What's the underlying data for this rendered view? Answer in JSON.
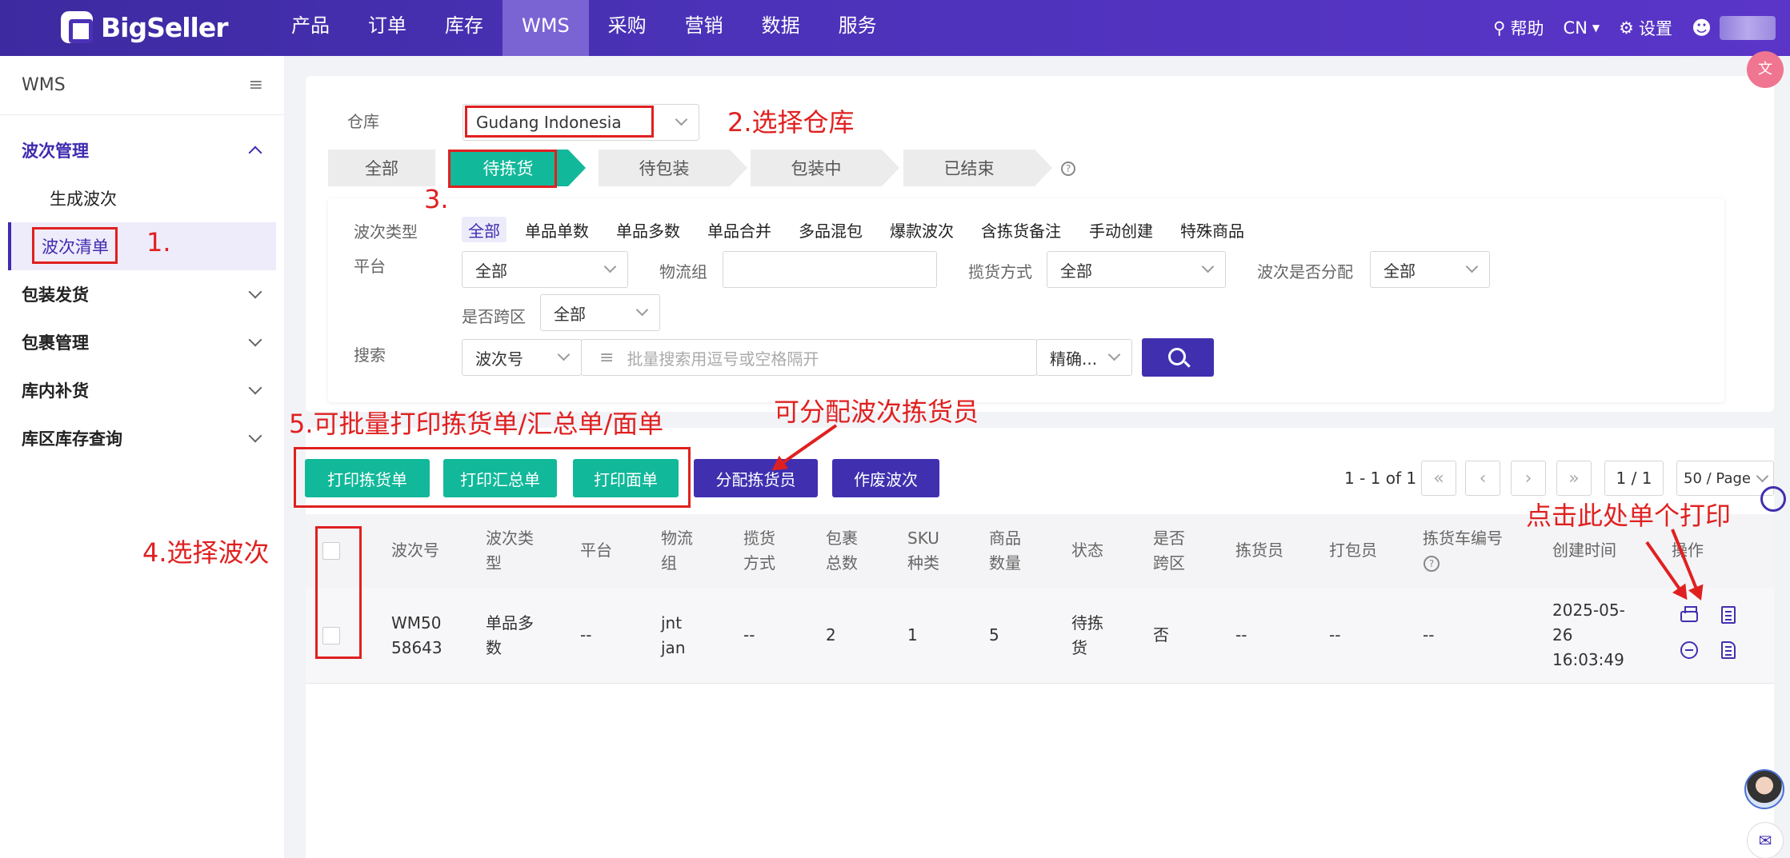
{
  "brand": {
    "name": "BigSeller"
  },
  "nav": [
    "产品",
    "订单",
    "库存",
    "WMS",
    "采购",
    "营销",
    "数据",
    "服务"
  ],
  "nav_active": "WMS",
  "top_right": {
    "help": "帮助",
    "lang": "CN",
    "settings": "设置"
  },
  "sidebar": {
    "title": "WMS",
    "groups": [
      {
        "label": "波次管理",
        "open": true,
        "items": [
          "生成波次",
          "波次清单"
        ],
        "active_item": "波次清单"
      },
      {
        "label": "包装发货"
      },
      {
        "label": "包裹管理"
      },
      {
        "label": "库内补货"
      },
      {
        "label": "库区库存查询"
      }
    ]
  },
  "filters": {
    "warehouse_label": "仓库",
    "warehouse_value": "Gudang Indonesia",
    "status_tabs": [
      "全部",
      "待拣货",
      "待包装",
      "包装中",
      "已结束"
    ],
    "status_active": "待拣货",
    "wave_type_label": "波次类型",
    "wave_types": [
      "全部",
      "单品单数",
      "单品多数",
      "单品合并",
      "多品混包",
      "爆款波次",
      "含拣货备注",
      "手动创建",
      "特殊商品"
    ],
    "platform_label": "平台",
    "platform_value": "全部",
    "logistics_label": "物流组",
    "pickup_label": "揽货方式",
    "pickup_value": "全部",
    "assigned_label": "波次是否分配",
    "assigned_value": "全部",
    "cross_zone_label": "是否跨区",
    "cross_zone_value": "全部",
    "search_label": "搜索",
    "search_field": "波次号",
    "search_placeholder": "批量搜索用逗号或空格隔开",
    "search_mode": "精确..."
  },
  "actions": {
    "print_pick": "打印拣货单",
    "print_summary": "打印汇总单",
    "print_label": "打印面单",
    "assign_picker": "分配拣货员",
    "void_wave": "作废波次"
  },
  "pagination": {
    "range": "1 - 1 of 1",
    "page": "1 / 1",
    "page_size": "50 / Page"
  },
  "table": {
    "headers": [
      "波次号",
      "波次类型",
      "平台",
      "物流组",
      "揽货方式",
      "包裹总数",
      "SKU种类",
      "商品数量",
      "状态",
      "是否跨区",
      "拣货员",
      "打包员",
      "拣货车编号",
      "创建时间",
      "操作"
    ],
    "rows": [
      {
        "wave_no": "WM5058643",
        "wave_type": "单品多数",
        "platform": "--",
        "logistics": "jnt jan",
        "pickup": "--",
        "packages": "2",
        "sku_types": "1",
        "quantity": "5",
        "status": "待拣货",
        "cross_zone": "否",
        "picker": "--",
        "packer": "--",
        "cart_no": "--",
        "created": "2025-05-26 16:03:49"
      }
    ]
  },
  "annotations": {
    "a1": "1.",
    "a2": "2.选择仓库",
    "a3": "3.",
    "a4": "4.选择波次",
    "a5": "5.可批量打印拣货单/汇总单/面单",
    "a_assign": "可分配波次拣货员",
    "a_single": "点击此处单个打印"
  },
  "colors": {
    "brand": "#4a31b5",
    "green": "#12b89a",
    "annotation": "#e02020"
  }
}
